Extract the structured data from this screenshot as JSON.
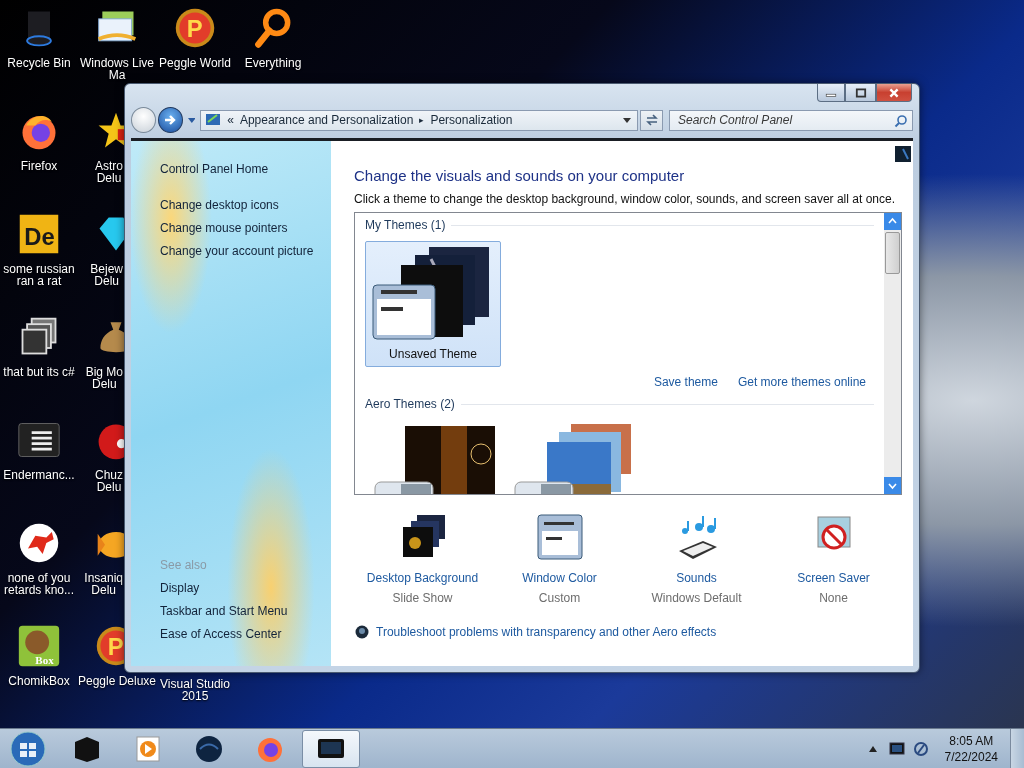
{
  "desktop": {
    "columns": [
      [
        {
          "label": "Recycle Bin",
          "kind": "bin"
        },
        {
          "label": "Firefox",
          "kind": "firefox"
        },
        {
          "label": "some russian\nran a rat",
          "kind": "letters",
          "icon_text": "De"
        },
        {
          "label": "that but its c#",
          "kind": "stack"
        },
        {
          "label": "Endermanc...",
          "kind": "terminal"
        },
        {
          "label": "none of you\nretards kno...",
          "kind": "dino"
        },
        {
          "label": "ChomikBox",
          "kind": "hamster",
          "icon_text": "Box"
        }
      ],
      [
        {
          "label": "Windows Live\nMa",
          "kind": "mail"
        },
        {
          "label": "Astro\nDelu",
          "kind": "star"
        },
        {
          "label": "Bejew\nDelu",
          "kind": "gem"
        },
        {
          "label": "Big Mo\nDelu",
          "kind": "bag"
        },
        {
          "label": "Chuz\nDelu",
          "kind": "ball"
        },
        {
          "label": "Insaniq\nDelu",
          "kind": "fish"
        },
        {
          "label": "Peggle Deluxe",
          "kind": "peggle",
          "icon_text": "P"
        }
      ],
      [
        {
          "label": "Peggle World",
          "kind": "peggle",
          "icon_text": "P"
        },
        {
          "label": "Visual Studio\n2015",
          "kind": "none"
        }
      ],
      [
        {
          "label": "Everything",
          "kind": "search"
        }
      ]
    ]
  },
  "window": {
    "address": {
      "overflow": "«",
      "crumbs": [
        "Appearance and Personalization",
        "Personalization"
      ],
      "separator": "▸"
    },
    "search": {
      "placeholder": "Search Control Panel"
    },
    "sidebar": {
      "links": [
        "Control Panel Home",
        "Change desktop icons",
        "Change mouse pointers",
        "Change your account picture"
      ],
      "see_also": {
        "title": "See also",
        "links": [
          "Display",
          "Taskbar and Start Menu",
          "Ease of Access Center"
        ]
      }
    },
    "heading": "Change the visuals and sounds on your computer",
    "description": "Click a theme to change the desktop background, window color, sounds, and screen saver all at once.",
    "theme_groups": [
      {
        "title": "My Themes (1)",
        "themes": [
          {
            "name": "Unsaved Theme",
            "kind": "slides",
            "selected": true
          }
        ],
        "links": [
          "Save theme",
          "Get more themes online"
        ]
      },
      {
        "title": "Aero Themes (2)",
        "themes": [
          {
            "kind": "glow",
            "selected": false
          },
          {
            "kind": "landscapes",
            "selected": false
          }
        ]
      }
    ],
    "settings": [
      {
        "kind": "background",
        "title": "Desktop Background",
        "value": "Slide Show"
      },
      {
        "kind": "color",
        "title": "Window Color",
        "value": "Custom"
      },
      {
        "kind": "sounds",
        "title": "Sounds",
        "value": "Windows Default"
      },
      {
        "kind": "saver",
        "title": "Screen Saver",
        "value": "None"
      }
    ],
    "troubleshoot": "Troubleshoot problems with transparency and other Aero effects"
  },
  "taskbar": {
    "items": [
      {
        "kind": "box",
        "selected": false
      },
      {
        "kind": "player",
        "selected": false
      },
      {
        "kind": "globe",
        "selected": false
      },
      {
        "kind": "firefox",
        "selected": false
      },
      {
        "kind": "panel",
        "selected": true
      }
    ],
    "clock": {
      "time": "8:05 AM",
      "date": "7/22/2024"
    }
  }
}
